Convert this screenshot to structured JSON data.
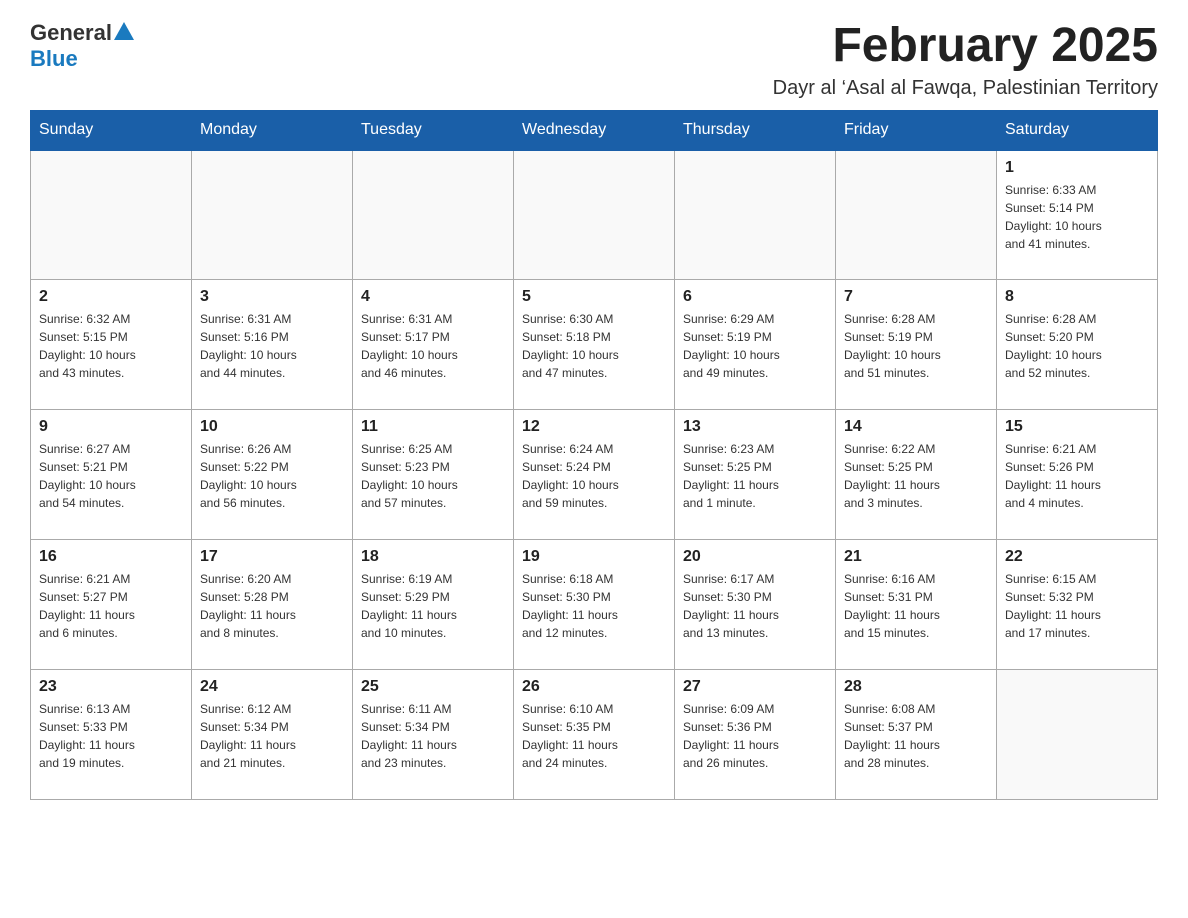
{
  "logo": {
    "general": "General",
    "blue": "Blue"
  },
  "title": "February 2025",
  "location": "Dayr al ‘Asal al Fawqa, Palestinian Territory",
  "days_header": [
    "Sunday",
    "Monday",
    "Tuesday",
    "Wednesday",
    "Thursday",
    "Friday",
    "Saturday"
  ],
  "weeks": [
    [
      {
        "day": "",
        "info": ""
      },
      {
        "day": "",
        "info": ""
      },
      {
        "day": "",
        "info": ""
      },
      {
        "day": "",
        "info": ""
      },
      {
        "day": "",
        "info": ""
      },
      {
        "day": "",
        "info": ""
      },
      {
        "day": "1",
        "info": "Sunrise: 6:33 AM\nSunset: 5:14 PM\nDaylight: 10 hours\nand 41 minutes."
      }
    ],
    [
      {
        "day": "2",
        "info": "Sunrise: 6:32 AM\nSunset: 5:15 PM\nDaylight: 10 hours\nand 43 minutes."
      },
      {
        "day": "3",
        "info": "Sunrise: 6:31 AM\nSunset: 5:16 PM\nDaylight: 10 hours\nand 44 minutes."
      },
      {
        "day": "4",
        "info": "Sunrise: 6:31 AM\nSunset: 5:17 PM\nDaylight: 10 hours\nand 46 minutes."
      },
      {
        "day": "5",
        "info": "Sunrise: 6:30 AM\nSunset: 5:18 PM\nDaylight: 10 hours\nand 47 minutes."
      },
      {
        "day": "6",
        "info": "Sunrise: 6:29 AM\nSunset: 5:19 PM\nDaylight: 10 hours\nand 49 minutes."
      },
      {
        "day": "7",
        "info": "Sunrise: 6:28 AM\nSunset: 5:19 PM\nDaylight: 10 hours\nand 51 minutes."
      },
      {
        "day": "8",
        "info": "Sunrise: 6:28 AM\nSunset: 5:20 PM\nDaylight: 10 hours\nand 52 minutes."
      }
    ],
    [
      {
        "day": "9",
        "info": "Sunrise: 6:27 AM\nSunset: 5:21 PM\nDaylight: 10 hours\nand 54 minutes."
      },
      {
        "day": "10",
        "info": "Sunrise: 6:26 AM\nSunset: 5:22 PM\nDaylight: 10 hours\nand 56 minutes."
      },
      {
        "day": "11",
        "info": "Sunrise: 6:25 AM\nSunset: 5:23 PM\nDaylight: 10 hours\nand 57 minutes."
      },
      {
        "day": "12",
        "info": "Sunrise: 6:24 AM\nSunset: 5:24 PM\nDaylight: 10 hours\nand 59 minutes."
      },
      {
        "day": "13",
        "info": "Sunrise: 6:23 AM\nSunset: 5:25 PM\nDaylight: 11 hours\nand 1 minute."
      },
      {
        "day": "14",
        "info": "Sunrise: 6:22 AM\nSunset: 5:25 PM\nDaylight: 11 hours\nand 3 minutes."
      },
      {
        "day": "15",
        "info": "Sunrise: 6:21 AM\nSunset: 5:26 PM\nDaylight: 11 hours\nand 4 minutes."
      }
    ],
    [
      {
        "day": "16",
        "info": "Sunrise: 6:21 AM\nSunset: 5:27 PM\nDaylight: 11 hours\nand 6 minutes."
      },
      {
        "day": "17",
        "info": "Sunrise: 6:20 AM\nSunset: 5:28 PM\nDaylight: 11 hours\nand 8 minutes."
      },
      {
        "day": "18",
        "info": "Sunrise: 6:19 AM\nSunset: 5:29 PM\nDaylight: 11 hours\nand 10 minutes."
      },
      {
        "day": "19",
        "info": "Sunrise: 6:18 AM\nSunset: 5:30 PM\nDaylight: 11 hours\nand 12 minutes."
      },
      {
        "day": "20",
        "info": "Sunrise: 6:17 AM\nSunset: 5:30 PM\nDaylight: 11 hours\nand 13 minutes."
      },
      {
        "day": "21",
        "info": "Sunrise: 6:16 AM\nSunset: 5:31 PM\nDaylight: 11 hours\nand 15 minutes."
      },
      {
        "day": "22",
        "info": "Sunrise: 6:15 AM\nSunset: 5:32 PM\nDaylight: 11 hours\nand 17 minutes."
      }
    ],
    [
      {
        "day": "23",
        "info": "Sunrise: 6:13 AM\nSunset: 5:33 PM\nDaylight: 11 hours\nand 19 minutes."
      },
      {
        "day": "24",
        "info": "Sunrise: 6:12 AM\nSunset: 5:34 PM\nDaylight: 11 hours\nand 21 minutes."
      },
      {
        "day": "25",
        "info": "Sunrise: 6:11 AM\nSunset: 5:34 PM\nDaylight: 11 hours\nand 23 minutes."
      },
      {
        "day": "26",
        "info": "Sunrise: 6:10 AM\nSunset: 5:35 PM\nDaylight: 11 hours\nand 24 minutes."
      },
      {
        "day": "27",
        "info": "Sunrise: 6:09 AM\nSunset: 5:36 PM\nDaylight: 11 hours\nand 26 minutes."
      },
      {
        "day": "28",
        "info": "Sunrise: 6:08 AM\nSunset: 5:37 PM\nDaylight: 11 hours\nand 28 minutes."
      },
      {
        "day": "",
        "info": ""
      }
    ]
  ]
}
